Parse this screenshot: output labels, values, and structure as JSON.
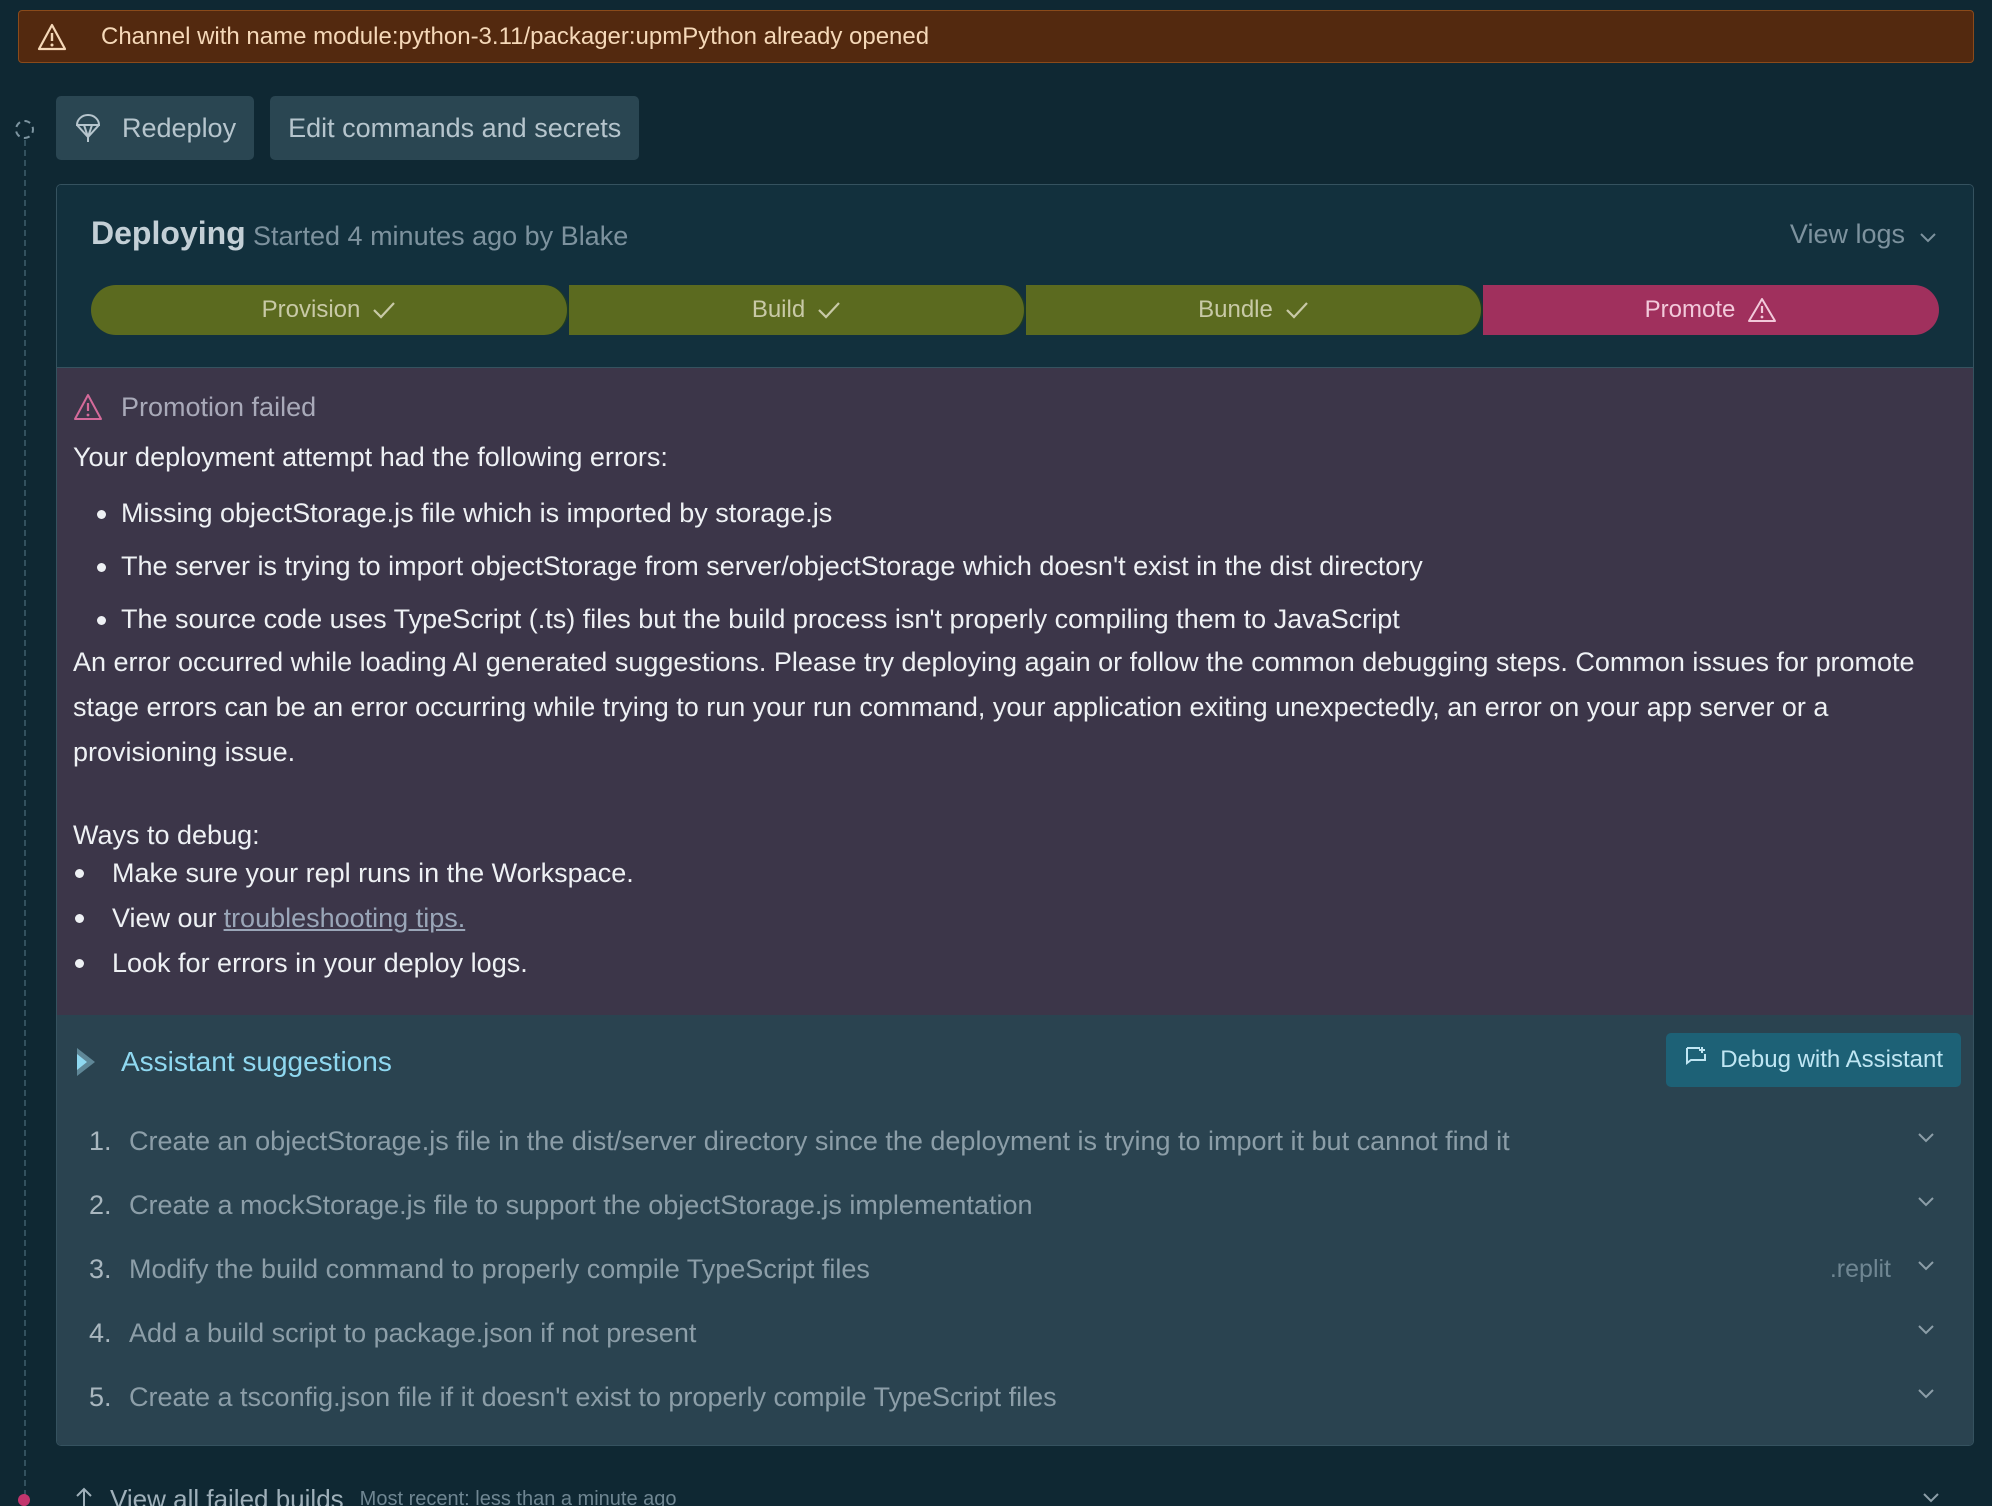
{
  "banner": {
    "icon": "warning-triangle-icon",
    "text": "Channel with name module:python-3.11/packager:upmPython already opened"
  },
  "actions": {
    "redeploy_label": "Redeploy",
    "edit_label": "Edit commands and secrets"
  },
  "deployment": {
    "status": "Deploying",
    "subtitle": "Started 4 minutes ago by Blake",
    "view_logs_label": "View logs",
    "stages": [
      {
        "label": "Provision",
        "state": "success"
      },
      {
        "label": "Build",
        "state": "success"
      },
      {
        "label": "Bundle",
        "state": "success"
      },
      {
        "label": "Promote",
        "state": "failed"
      }
    ],
    "colors": {
      "success": "#5b6a1f",
      "failed": "#a0305d"
    }
  },
  "error": {
    "title": "Promotion failed",
    "intro": "Your deployment attempt had the following errors:",
    "items": [
      "Missing objectStorage.js file which is imported by storage.js",
      "The server is trying to import objectStorage from server/objectStorage which doesn't exist in the dist directory",
      "The source code uses TypeScript (.ts) files but the build process isn't properly compiling them to JavaScript"
    ],
    "paragraph": "An error occurred while loading AI generated suggestions. Please try deploying again or follow the common debugging steps. Common issues for promote stage errors can be an error occurring while trying to run your run command, your application exiting unexpectedly, an error on your app server or a provisioning issue.",
    "ways_title": "Ways to debug:",
    "ways": {
      "item1": "Make sure your repl runs in the Workspace.",
      "item2_prefix": "View our",
      "item2_link": "troubleshooting tips.",
      "item3": "Look for errors in your deploy logs."
    }
  },
  "assistant": {
    "title": "Assistant suggestions",
    "debug_button": "Debug with Assistant",
    "suggestions": [
      {
        "num": "1.",
        "text": "Create an objectStorage.js file in the dist/server directory since the deployment is trying to import it but cannot find it",
        "tag": ""
      },
      {
        "num": "2.",
        "text": "Create a mockStorage.js file to support the objectStorage.js implementation",
        "tag": ""
      },
      {
        "num": "3.",
        "text": "Modify the build command to properly compile TypeScript files",
        "tag": ".replit"
      },
      {
        "num": "4.",
        "text": "Add a build script to package.json if not present",
        "tag": ""
      },
      {
        "num": "5.",
        "text": "Create a tsconfig.json file if it doesn't exist to properly compile TypeScript files",
        "tag": ""
      }
    ]
  },
  "failed_builds": {
    "label": "View all failed builds",
    "sub": "Most recent: less than a minute ago"
  }
}
